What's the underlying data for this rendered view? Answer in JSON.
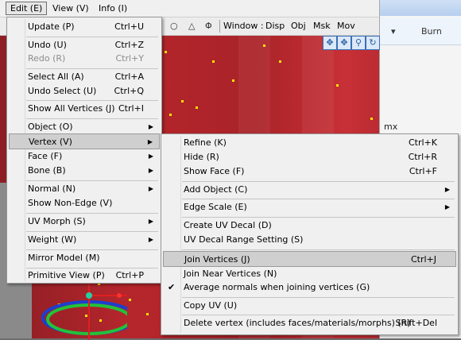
{
  "menubar": {
    "edit": "Edit (E)",
    "view": "View (V)",
    "info": "Info (I)"
  },
  "toolbar": {
    "shapes": [
      "○",
      "△",
      "Φ"
    ],
    "window_label": "Window :",
    "items": [
      "Disp",
      "Obj",
      "Msk",
      "Mov"
    ]
  },
  "right_window": {
    "dropdown_arrow": "▾",
    "burn": "Burn",
    "file_suffix": "mx"
  },
  "edit_menu": {
    "items": [
      {
        "label": "Update (P)",
        "shortcut": "Ctrl+U"
      },
      {
        "label": "Undo (U)",
        "shortcut": "Ctrl+Z"
      },
      {
        "label": "Redo (R)",
        "shortcut": "Ctrl+Y",
        "disabled": true
      },
      {
        "label": "Select All (A)",
        "shortcut": "Ctrl+A"
      },
      {
        "label": "Undo Select (U)",
        "shortcut": "Ctrl+Q"
      },
      {
        "label": "Show All Vertices (J)",
        "shortcut": "Ctrl+I"
      },
      {
        "label": "Object (O)"
      },
      {
        "label": "Vertex (V)"
      },
      {
        "label": "Face (F)"
      },
      {
        "label": "Bone (B)"
      },
      {
        "label": "Normal (N)"
      },
      {
        "label": "Show Non-Edge (V)"
      },
      {
        "label": "UV Morph (S)"
      },
      {
        "label": "Weight (W)"
      },
      {
        "label": "Mirror Model (M)"
      },
      {
        "label": "Primitive View (P)",
        "shortcut": "Ctrl+P"
      }
    ]
  },
  "vertex_menu": {
    "items": [
      {
        "label": "Refine (K)",
        "shortcut": "Ctrl+K"
      },
      {
        "label": "Hide (R)",
        "shortcut": "Ctrl+R"
      },
      {
        "label": "Show Face (F)",
        "shortcut": "Ctrl+F"
      },
      {
        "label": "Add Object (C)"
      },
      {
        "label": "Edge Scale (E)"
      },
      {
        "label": "Create UV Decal (D)"
      },
      {
        "label": "UV Decal Range Setting (S)"
      },
      {
        "label": "Join Vertices (J)",
        "shortcut": "Ctrl+J"
      },
      {
        "label": "Join Near Vertices (N)"
      },
      {
        "label": "Average normals when joining vertices (G)",
        "checked": true
      },
      {
        "label": "Copy UV (U)"
      },
      {
        "label": "Delete vertex (includes faces/materials/morphs) (R)",
        "shortcut": "Shift+Del"
      }
    ]
  },
  "symbols": {
    "submenu_arrow": "▶",
    "check": "✔"
  },
  "colors": {
    "viewport_red": "#b5262c",
    "vertex_dot": "#ffe100",
    "menu_bg": "#f0f0f0",
    "menu_highlight": "#cfcfcf"
  }
}
